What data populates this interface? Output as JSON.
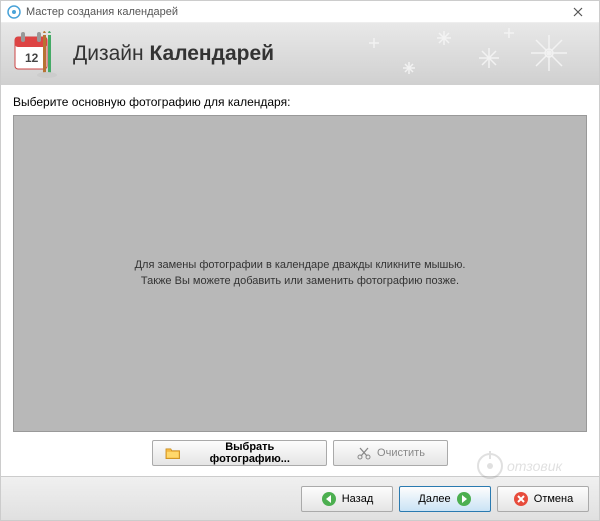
{
  "window": {
    "title": "Мастер создания календарей"
  },
  "header": {
    "title_light": "Дизайн ",
    "title_bold": "Календарей"
  },
  "main": {
    "instruction": "Выберите основную фотографию для календаря:",
    "placeholder_line1": "Для замены фотографии в календаре дважды кликните мышью.",
    "placeholder_line2": "Также Вы можете добавить или заменить фотографию позже."
  },
  "buttons": {
    "select_photo": "Выбрать фотографию...",
    "clear": "Очистить",
    "back": "Назад",
    "next": "Далее",
    "cancel": "Отмена"
  }
}
